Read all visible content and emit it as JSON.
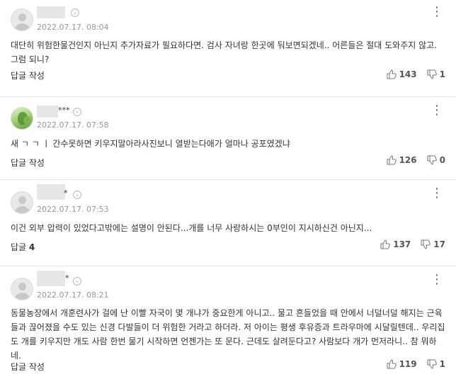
{
  "comments": [
    {
      "name_suffix": "",
      "date": "2022.07.17. 08:04",
      "text": "대단히 위험한물건인지 아닌지 추가자료가 필요하다면. 검사 자녀랑 한곳에 둬보면되겠네.. 어른들은 절대 도와주지 않고. 그럼 되니?",
      "reply_label": "답글 작성",
      "reply_count": "",
      "likes": "143",
      "dislikes": "1"
    },
    {
      "name_suffix": "***",
      "date": "2022.07.17. 07:58",
      "text": "새 ㄱ ㄱ ㅣ 간수못하면 키우지말아라사진보니 열받는다애가 얼마나 공포였겠냐",
      "reply_label": "답글 작성",
      "reply_count": "",
      "likes": "126",
      "dislikes": "0"
    },
    {
      "name_suffix": "*",
      "date": "2022.07.17. 07:53",
      "text": "이건 외부 압력이 있었다고밖에는 설명이 안된다...개를 너무 사랑하시는 0부인이 지시하신건 아닌지...",
      "reply_label": "답글",
      "reply_count": "4",
      "likes": "137",
      "dislikes": "17"
    },
    {
      "name_suffix": "*",
      "date": "2022.07.17. 08:21",
      "text": "동물농장에서 개훈련사가 걸에 난 이빨 자국이 몇 개냐가 중요한게 아니고.. 물고 흔들었을 때 안에서 너덜너덜 해지는 근육들과 끊어졌을 수도 있는 신경 다발들이 더 위험한 거라고 하더라. 저 아이는 평생 후유증과 트라우마에 시달릴텐데.. 우리집도 개를 키우지만 개도 사람 한번 물기 시작하면 언젠가는 또 문다. 근데도 살려둔다고? 사람보다 개가 먼저라니.. 참 뭐하네.",
      "reply_label": "답글 작성",
      "reply_count": "",
      "likes": "119",
      "dislikes": "1"
    }
  ],
  "icons": {
    "like": "thumbs-up-icon",
    "dislike": "thumbs-down-icon",
    "more": "more-vertical-icon",
    "profile": "chevron-right-icon"
  }
}
